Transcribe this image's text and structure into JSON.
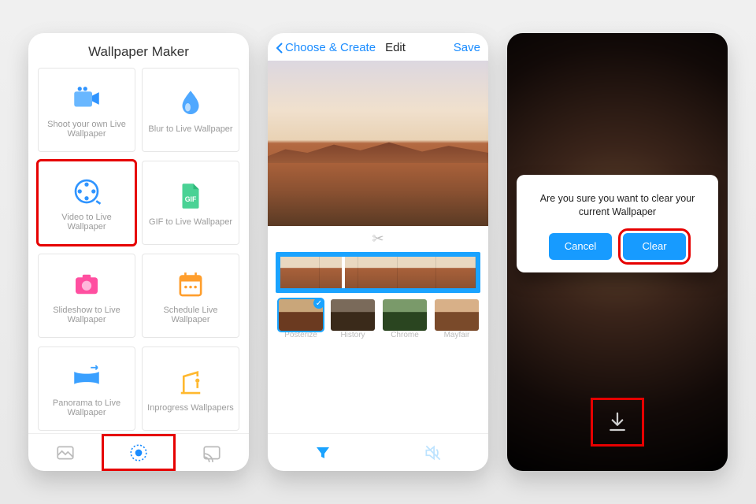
{
  "phone1": {
    "title": "Wallpaper Maker",
    "cards": [
      "Shoot your own Live Wallpaper",
      "Blur to Live Wallpaper",
      "Video to Live Wallpaper",
      "GIF to Live Wallpaper",
      "Slideshow to Live Wallpaper",
      "Schedule Live Wallpaper",
      "Panorama to Live Wallpaper",
      "Inprogress Wallpapers"
    ]
  },
  "phone2": {
    "back": "Choose & Create",
    "title": "Edit",
    "save": "Save",
    "filters": [
      "Posterize",
      "History",
      "Chrome",
      "Mayfair"
    ]
  },
  "phone3": {
    "message": "Are you sure you want to clear your current Wallpaper",
    "cancel": "Cancel",
    "clear": "Clear"
  }
}
